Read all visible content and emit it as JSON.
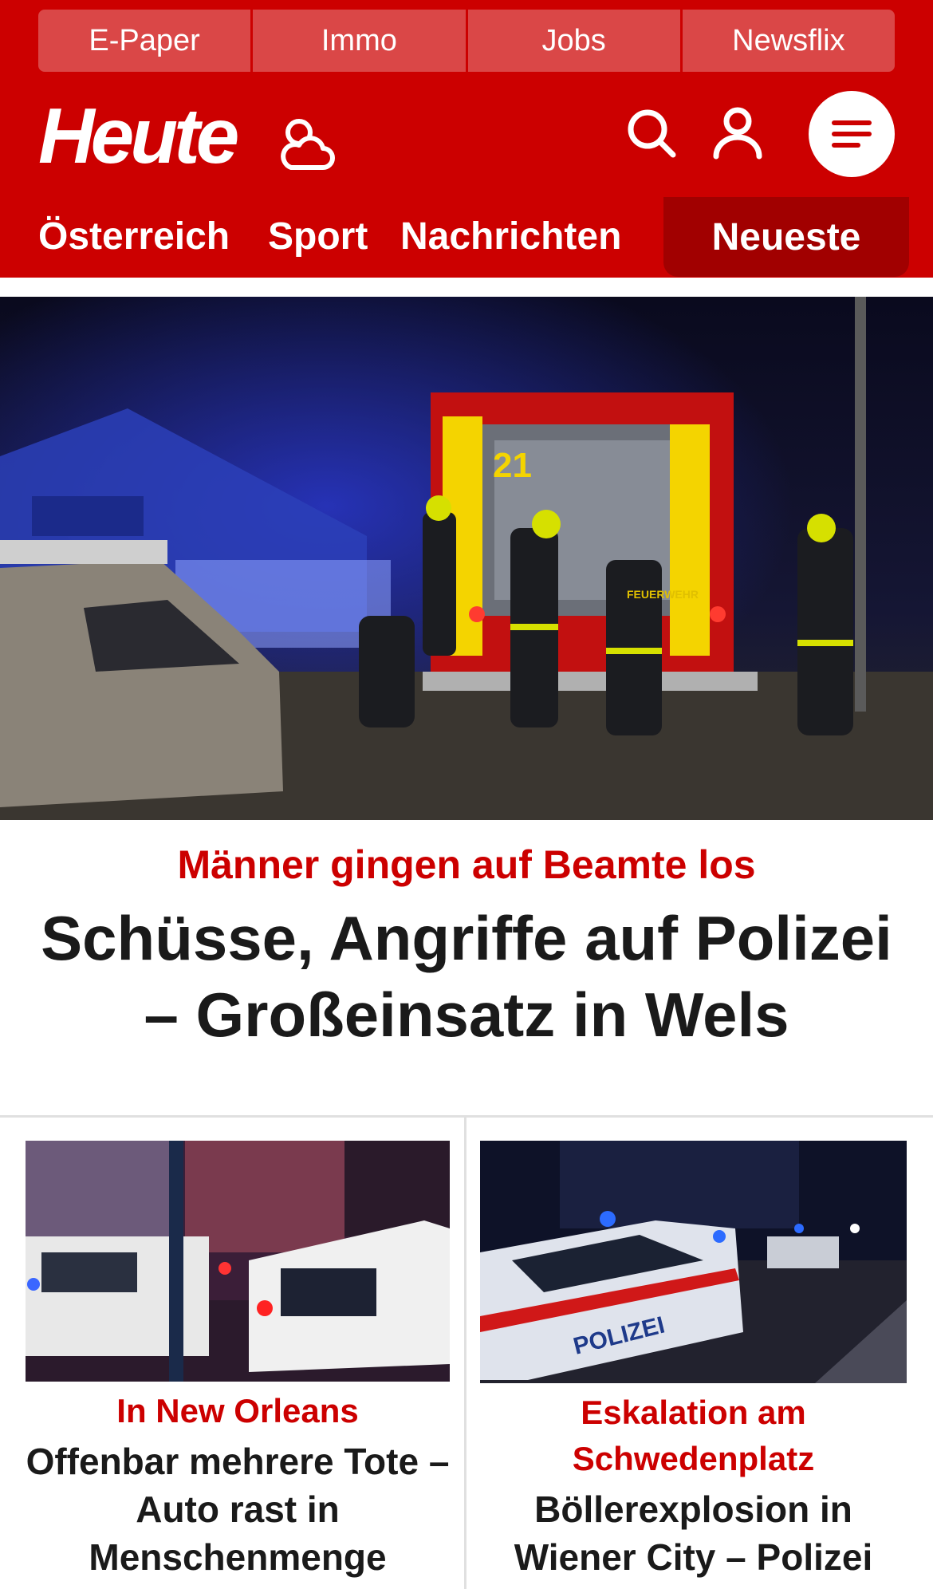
{
  "topnav": {
    "items": [
      {
        "label": "E-Paper"
      },
      {
        "label": "Immo"
      },
      {
        "label": "Jobs"
      },
      {
        "label": "Newsflix"
      }
    ]
  },
  "brand": {
    "logo_text": "Heute",
    "accent_color": "#cc0000"
  },
  "header_icons": [
    "weather-icon",
    "search-icon",
    "user-icon",
    "menu-icon"
  ],
  "sections": {
    "items": [
      {
        "label": "Österreich"
      },
      {
        "label": "Sport"
      },
      {
        "label": "Nachrichten"
      },
      {
        "label": "Neueste"
      }
    ]
  },
  "hero": {
    "kicker": "Männer gingen auf Beamte los",
    "title": "Schüsse, Angriffe auf Polizei – Großeinsatz in Wels",
    "image_text": {
      "truck_number": "21",
      "jacket_label": "FEUERWEHR"
    }
  },
  "teasers": [
    {
      "kicker": "In New Orleans",
      "title": "Offenbar mehrere Tote – Auto rast in Menschenmenge"
    },
    {
      "kicker": "Eskalation am Schwedenplatz",
      "title": "Böllerexplosion in Wiener City – Polizei",
      "image_text": {
        "car_label": "POLIZEI"
      }
    }
  ]
}
